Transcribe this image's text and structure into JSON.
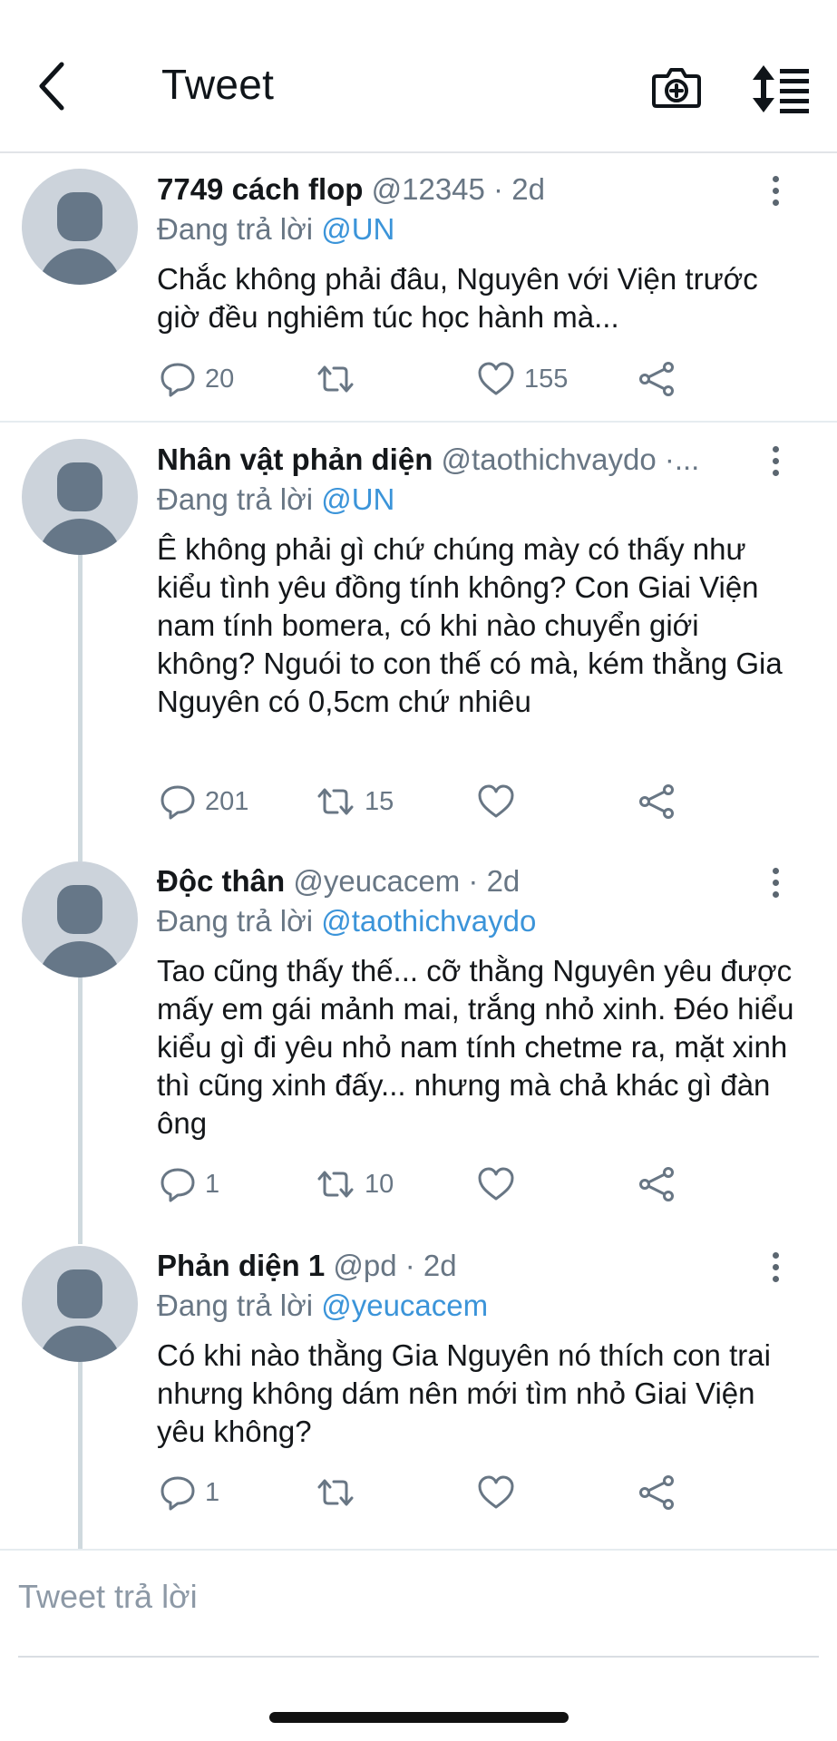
{
  "header": {
    "title": "Tweet"
  },
  "tweets": [
    {
      "name": "7749 cách flop",
      "handle": "@12345 · 2d",
      "replying_prefix": "Đang trả lời ",
      "replying_to": "@UN",
      "text": "Chắc không phải đâu, Nguyên với Viện trước giờ đều nghiêm túc học hành mà...",
      "replies": "20",
      "retweets": "",
      "likes": "155"
    },
    {
      "name": "Nhân vật phản diện",
      "handle": "@taothichvaydo ·...",
      "replying_prefix": "Đang trả lời ",
      "replying_to": "@UN",
      "text": "Ê không phải gì chứ chúng mày có thấy như kiểu tình yêu đồng tính không? Con Giai Viện nam tính bomera, có khi nào chuyển giới không? Nguói to con thế có mà, kém thằng Gia Nguyên có 0,5cm chứ nhiêu",
      "replies": "201",
      "retweets": "15",
      "likes": ""
    },
    {
      "name": "Độc thân",
      "handle": "@yeucacem · 2d",
      "replying_prefix": "Đang trả lời ",
      "replying_to": "@taothichvaydo",
      "text": "Tao cũng thấy thế... cỡ thằng Nguyên yêu được mấy em gái mảnh mai, trắng nhỏ xinh. Đéo hiểu kiểu gì đi yêu nhỏ nam tính chetme ra, mặt xinh thì cũng xinh đấy... nhưng mà chả khác gì đàn ông",
      "replies": "1",
      "retweets": "10",
      "likes": ""
    },
    {
      "name": "Phản diện 1",
      "handle": "@pd · 2d",
      "replying_prefix": "Đang trả lời ",
      "replying_to": "@yeucacem",
      "text": "Có khi nào thằng Gia Nguyên nó thích con trai nhưng không dám nên mới tìm nhỏ Giai Viện yêu không?",
      "replies": "1",
      "retweets": "",
      "likes": ""
    }
  ],
  "composer": {
    "placeholder": "Tweet trả lời"
  },
  "icons": {
    "back": "chevron-left-icon",
    "camera": "camera-plus-icon",
    "sort": "sort-icon",
    "reply": "reply-icon",
    "retweet": "retweet-icon",
    "like": "heart-icon",
    "share": "share-icon",
    "more": "more-vertical-icon"
  },
  "colors": {
    "mention": "#3b94d9",
    "secondary_text": "#687684",
    "icon": "#687684"
  }
}
